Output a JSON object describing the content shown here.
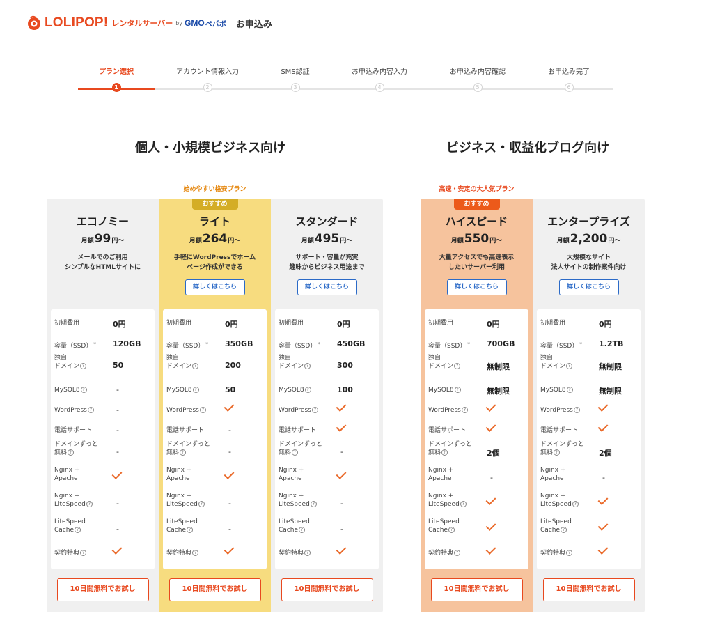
{
  "header": {
    "brand": "LOLIPOP!",
    "brand_sub": "レンタルサーバー",
    "brand_by": "by",
    "brand_gmo": "GMO",
    "brand_pepabo": "ペパボ",
    "title": "お申込み"
  },
  "stepper": {
    "steps": [
      {
        "label": "プラン選択",
        "num": "1",
        "active": true
      },
      {
        "label": "アカウント情報入力",
        "num": "2",
        "active": false
      },
      {
        "label": "SMS認証",
        "num": "3",
        "active": false
      },
      {
        "label": "お申込み内容入力",
        "num": "4",
        "active": false
      },
      {
        "label": "お申込み内容確認",
        "num": "5",
        "active": false
      },
      {
        "label": "お申込み完了",
        "num": "6",
        "active": false
      }
    ]
  },
  "sections": {
    "left_title": "個人・小規模ビジネス向け",
    "right_title": "ビジネス・収益化ブログ向け"
  },
  "price_prefix": "月額",
  "price_unit": "円〜",
  "detail_label": "詳しくはこちら",
  "trial_label": "10日間無料でお試し",
  "feature_labels": {
    "initial": "初期費用",
    "capacity": "容量（SSD）",
    "domain_1": "独自",
    "domain_2": "ドメイン",
    "mysql": "MySQL8",
    "wordpress": "WordPress",
    "phone": "電話サポート",
    "free_domain_1": "ドメインずっと",
    "free_domain_2": "無料",
    "nginx_apache_1": "Nginx +",
    "nginx_apache_2": "Apache",
    "nginx_ls_1": "Nginx +",
    "nginx_ls_2": "LiteSpeed",
    "lscache_1": "LiteSpeed",
    "lscache_2": "Cache",
    "benefit": "契約特典"
  },
  "plans": [
    {
      "tagline": "",
      "badge": "",
      "name": "エコノミー",
      "price": "99",
      "desc_1": "メールでのご利用",
      "desc_2": "シンプルなHTMLサイトに",
      "initial": "0円",
      "capacity": "120GB",
      "domain": "50",
      "mysql": "-",
      "wordpress": "-",
      "phone": "-",
      "free_domain": "-",
      "nginx_apache": "check",
      "nginx_ls": "-",
      "lscache": "-",
      "benefit": "check"
    },
    {
      "tagline": "始めやすい格安プラン",
      "badge": "おすすめ",
      "name": "ライト",
      "price": "264",
      "desc_1": "手軽にWordPressでホーム",
      "desc_2": "ページ作成ができる",
      "initial": "0円",
      "capacity": "350GB",
      "domain": "200",
      "mysql": "50",
      "wordpress": "check",
      "phone": "-",
      "free_domain": "-",
      "nginx_apache": "check",
      "nginx_ls": "-",
      "lscache": "-",
      "benefit": "check"
    },
    {
      "tagline": "",
      "badge": "",
      "name": "スタンダード",
      "price": "495",
      "desc_1": "サポート・容量が充実",
      "desc_2": "趣味からビジネス用途まで",
      "initial": "0円",
      "capacity": "450GB",
      "domain": "300",
      "mysql": "100",
      "wordpress": "check",
      "phone": "check",
      "free_domain": "-",
      "nginx_apache": "check",
      "nginx_ls": "-",
      "lscache": "-",
      "benefit": "check"
    },
    {
      "tagline": "高速・安定の大人気プラン",
      "badge": "おすすめ",
      "name": "ハイスピード",
      "price": "550",
      "desc_1": "大量アクセスでも高速表示",
      "desc_2": "したいサーバー利用",
      "initial": "0円",
      "capacity": "700GB",
      "domain": "無制限",
      "mysql": "無制限",
      "wordpress": "check",
      "phone": "check",
      "free_domain": "2個",
      "nginx_apache": "-",
      "nginx_ls": "check",
      "lscache": "check",
      "benefit": "check"
    },
    {
      "tagline": "",
      "badge": "",
      "name": "エンタープライズ",
      "price": "2,200",
      "desc_1": "大規模なサイト",
      "desc_2": "法人サイトの制作案件向け",
      "initial": "0円",
      "capacity": "1.2TB",
      "domain": "無制限",
      "mysql": "無制限",
      "wordpress": "check",
      "phone": "check",
      "free_domain": "2個",
      "nginx_apache": "-",
      "nginx_ls": "check",
      "lscache": "check",
      "benefit": "check"
    }
  ],
  "colors": {
    "brand_orange": "#e8491f",
    "lite_bg": "#f7dc7f",
    "highspeed_bg": "#f6c39d",
    "group_bg": "#f0f0f0",
    "link_blue": "#2b6ac7"
  }
}
